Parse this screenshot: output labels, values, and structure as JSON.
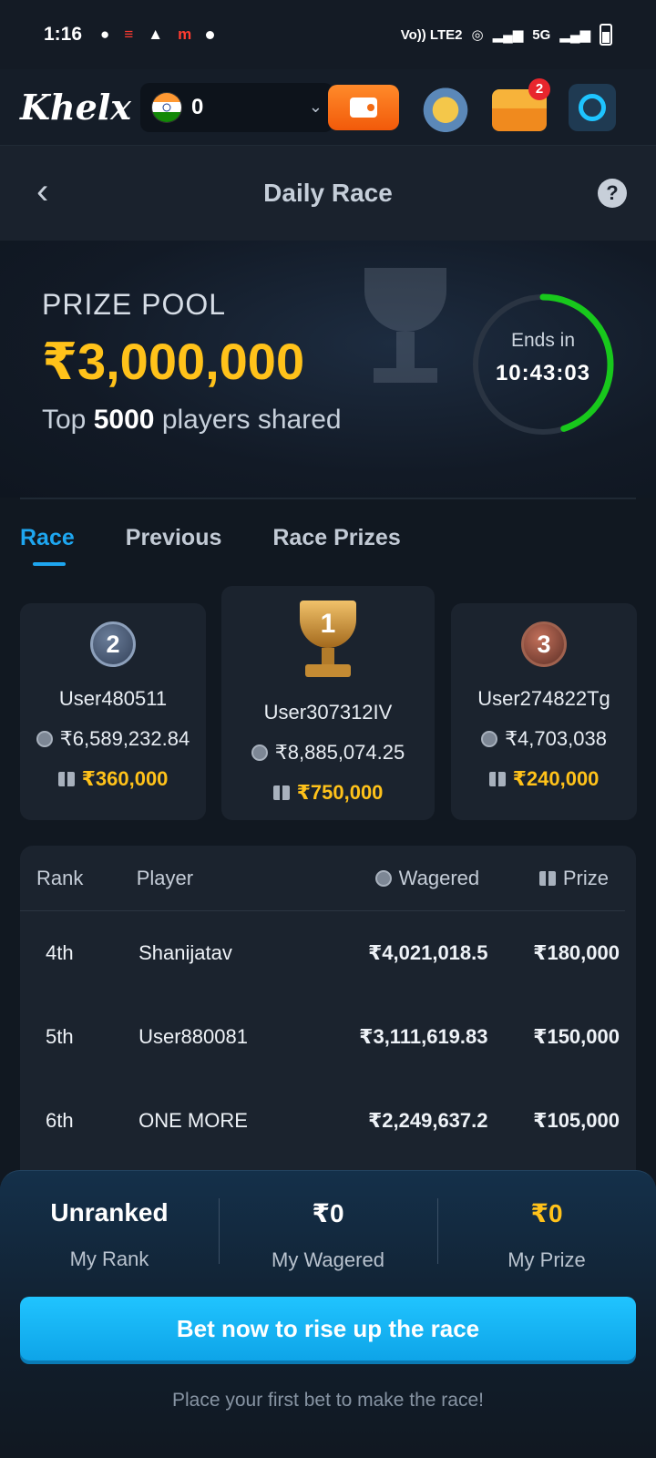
{
  "status_bar": {
    "time": "1:16",
    "network": "5G",
    "volte": "Vo)) LTE2"
  },
  "header": {
    "logo": "Khelx",
    "balance": "0",
    "notification_count": "2"
  },
  "title_bar": {
    "title": "Daily Race",
    "back_icon": "chevron-left-icon",
    "help_icon": "question-icon"
  },
  "hero": {
    "prize_label": "PRIZE POOL",
    "prize_amount": "₹3,000,000",
    "sub_prefix": "Top",
    "sub_count": "5000",
    "sub_suffix": "players shared",
    "timer_label": "Ends in",
    "timer_value": "10:43:03",
    "timer_progress": 0.45,
    "timer_color": "#18c81c"
  },
  "tabs": [
    {
      "label": "Race",
      "active": true
    },
    {
      "label": "Previous",
      "active": false
    },
    {
      "label": "Race Prizes",
      "active": false
    }
  ],
  "podium": {
    "first": {
      "rank": "1",
      "name": "User307312IV",
      "wagered": "₹8,885,074.25",
      "prize": "₹750,000"
    },
    "second": {
      "rank": "2",
      "name": "User480511",
      "wagered": "₹6,589,232.84",
      "prize": "₹360,000"
    },
    "third": {
      "rank": "3",
      "name": "User274822Tg",
      "wagered": "₹4,703,038",
      "prize": "₹240,000"
    }
  },
  "table": {
    "headers": {
      "rank": "Rank",
      "player": "Player",
      "wagered": "Wagered",
      "prize": "Prize"
    },
    "rows": [
      {
        "rank": "4th",
        "player": "Shanijatav",
        "wagered": "₹4,021,018.5",
        "prize": "₹180,000"
      },
      {
        "rank": "5th",
        "player": "User880081",
        "wagered": "₹3,111,619.83",
        "prize": "₹150,000"
      },
      {
        "rank": "6th",
        "player": "ONE MORE",
        "wagered": "₹2,249,637.2",
        "prize": "₹105,000"
      }
    ]
  },
  "my_stats": {
    "rank_value": "Unranked",
    "rank_label": "My Rank",
    "wagered_value": "₹0",
    "wagered_label": "My Wagered",
    "prize_value": "₹0",
    "prize_label": "My Prize"
  },
  "cta": {
    "button": "Bet now to rise up the race",
    "note": "Place your first bet to make the race!"
  },
  "colors": {
    "accent": "#1ea6f0",
    "gold": "#ffc21a",
    "wallet": "#f26b14"
  }
}
